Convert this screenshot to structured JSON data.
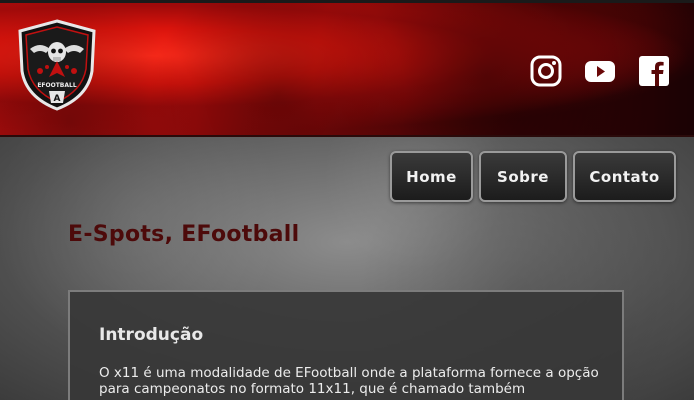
{
  "header": {
    "logo": {
      "icon": "efootball-skull-shield-logo",
      "text": "EFOOTBALL",
      "accent": "#d8130c"
    },
    "social": [
      {
        "icon": "instagram-icon"
      },
      {
        "icon": "youtube-icon"
      },
      {
        "icon": "facebook-icon"
      }
    ]
  },
  "nav": {
    "home_label": "Home",
    "sobre_label": "Sobre",
    "contato_label": "Contato"
  },
  "main": {
    "title": "E-Spots, EFootball",
    "title_color": "#4d0a0a",
    "intro": {
      "heading": "Introdução",
      "text": "O x11 é uma modalidade de EFootball onde a plataforma fornece a opção para campeonatos no formato 11x11, que é chamado também"
    }
  }
}
